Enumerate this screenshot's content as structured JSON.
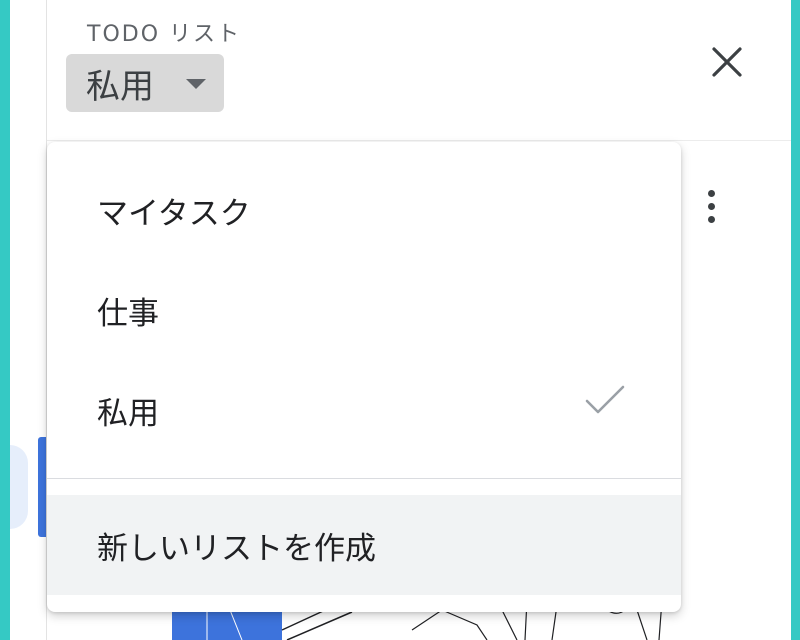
{
  "header": {
    "label": "TODO リスト",
    "selected_list": "私用",
    "close_icon": "close-icon",
    "more_icon": "more-vert-icon",
    "dropdown_icon": "caret-down-icon"
  },
  "menu": {
    "items": [
      {
        "label": "マイタスク",
        "selected": false
      },
      {
        "label": "仕事",
        "selected": false
      },
      {
        "label": "私用",
        "selected": true
      }
    ],
    "create_label": "新しいリストを作成",
    "check_icon": "check-icon"
  },
  "colors": {
    "frame": "#35c9c4",
    "accent_blue": "#3d73dc",
    "selector_bg": "#d9d9d9",
    "create_bg": "#f1f3f4"
  }
}
